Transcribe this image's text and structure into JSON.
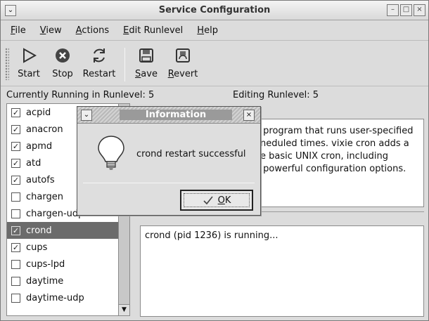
{
  "window": {
    "title": "Service Configuration"
  },
  "menubar": {
    "items": [
      {
        "pre": "",
        "key": "F",
        "post": "ile"
      },
      {
        "pre": "",
        "key": "V",
        "post": "iew"
      },
      {
        "pre": "",
        "key": "A",
        "post": "ctions"
      },
      {
        "pre": "",
        "key": "E",
        "post": "dit Runlevel"
      },
      {
        "pre": "",
        "key": "H",
        "post": "elp"
      }
    ]
  },
  "toolbar": {
    "start": {
      "label": "Start"
    },
    "stop": {
      "label": "Stop"
    },
    "restart": {
      "label": "Restart"
    },
    "save": {
      "key": "S",
      "rest": "ave"
    },
    "revert": {
      "key": "R",
      "rest": "evert"
    }
  },
  "status": {
    "current": "Currently Running in Runlevel: 5",
    "editing": "Editing Runlevel: 5"
  },
  "services": [
    {
      "name": "acpid",
      "checked": true
    },
    {
      "name": "anacron",
      "checked": true
    },
    {
      "name": "apmd",
      "checked": true
    },
    {
      "name": "atd",
      "checked": true
    },
    {
      "name": "autofs",
      "checked": true
    },
    {
      "name": "chargen",
      "checked": false
    },
    {
      "name": "chargen-udp",
      "checked": false
    },
    {
      "name": "crond",
      "checked": true,
      "selected": true
    },
    {
      "name": "cups",
      "checked": true
    },
    {
      "name": "cups-lpd",
      "checked": false
    },
    {
      "name": "daytime",
      "checked": false
    },
    {
      "name": "daytime-udp",
      "checked": false
    }
  ],
  "description": {
    "lines": [
      " program that runs user-specified",
      "neduled times. vixie cron adds a",
      "e basic UNIX cron, including",
      " powerful configuration options."
    ]
  },
  "service_status": "crond (pid 1236) is running...",
  "dialog": {
    "title": "Information",
    "message": "crond restart successful",
    "ok_key": "O",
    "ok_rest": "K"
  },
  "colors": {
    "selection": "#6b6b6b",
    "window_bg": "#dcdcdc"
  }
}
